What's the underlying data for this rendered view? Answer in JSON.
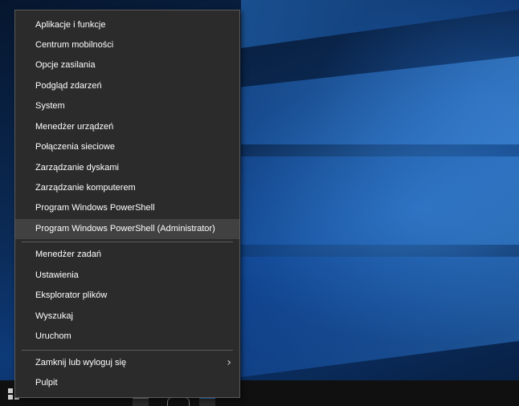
{
  "context_menu": {
    "group1": [
      "Aplikacje i funkcje",
      "Centrum mobilności",
      "Opcje zasilania",
      "Podgląd zdarzeń",
      "System",
      "Menedżer urządzeń",
      "Połączenia sieciowe",
      "Zarządzanie dyskami",
      "Zarządzanie komputerem",
      "Program Windows PowerShell",
      "Program Windows PowerShell (Administrator)"
    ],
    "group2": [
      "Menedżer zadań",
      "Ustawienia",
      "Eksplorator plików",
      "Wyszukaj",
      "Uruchom"
    ],
    "group3": [
      "Zamknij lub wyloguj się",
      "Pulpit"
    ],
    "highlighted_item": "Program Windows PowerShell (Administrator)",
    "submenu_arrow_icon": "chevron-right-icon"
  },
  "taskbar": {
    "start_icon": "windows-logo-icon"
  },
  "colors": {
    "menu_background": "#2b2b2b",
    "menu_highlight": "#414141",
    "menu_text": "#ffffff",
    "taskbar": "#101010",
    "accent": "#2b7cd3"
  }
}
